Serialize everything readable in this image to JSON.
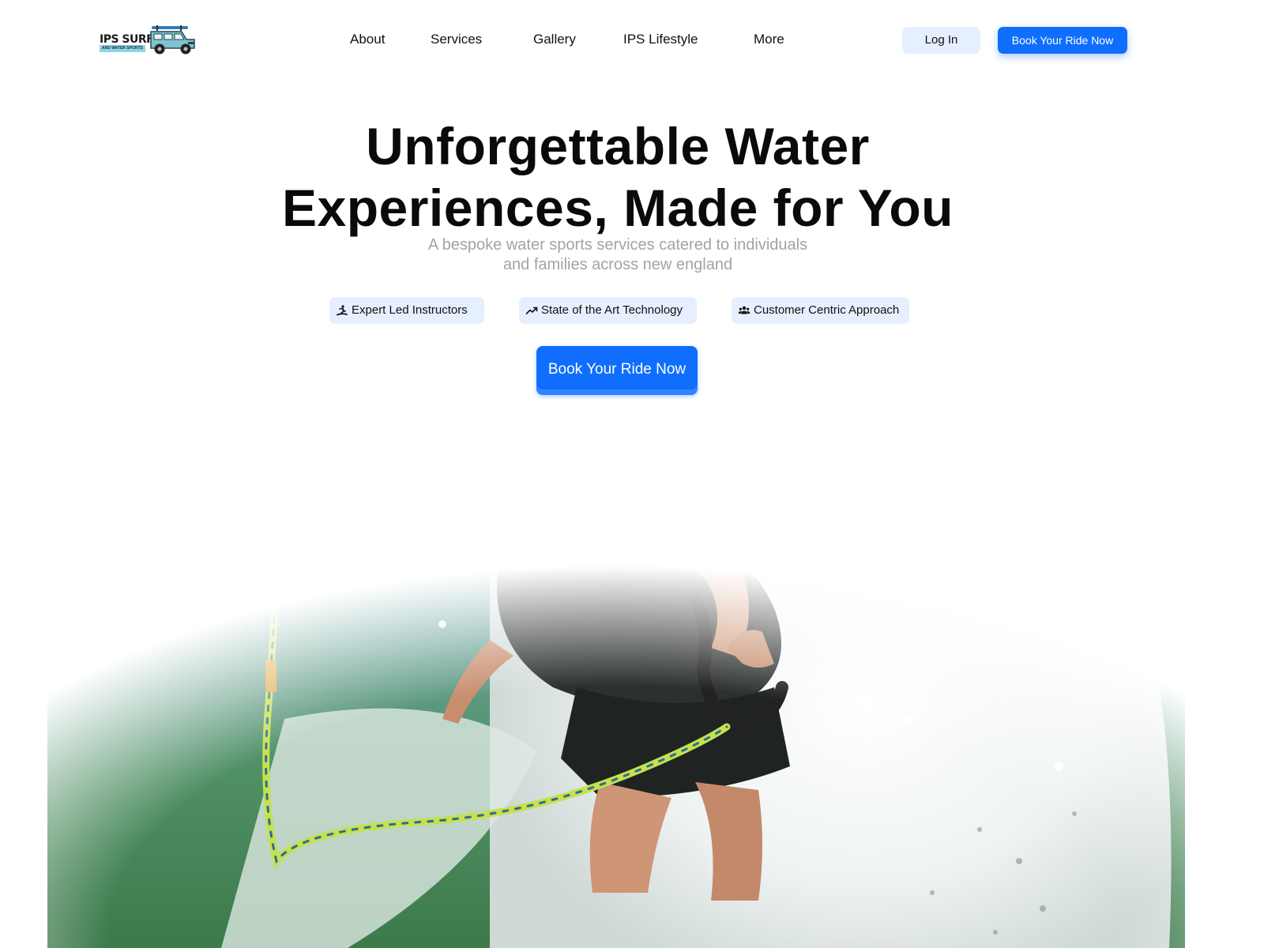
{
  "brand": {
    "name": "IPS SURF",
    "tagline": "AND WATER SPORTS",
    "logo_icon": "jeep-with-surfboard-icon"
  },
  "nav": {
    "links": [
      "About",
      "Services",
      "Gallery",
      "IPS Lifestyle",
      "More"
    ],
    "login_label": "Log In",
    "book_label": "Book Your Ride Now"
  },
  "hero": {
    "title_line1": "Unforgettable Water",
    "title_line2": "Experiences, Made for You",
    "subtitle_line1": "A bespoke water sports services catered to individuals",
    "subtitle_line2": "and families across new england",
    "features": [
      {
        "label": "Expert Led Instructors",
        "icon": "surfer-icon"
      },
      {
        "label": "State of the Art Technology",
        "icon": "trending-up-icon"
      },
      {
        "label": "Customer Centric Approach",
        "icon": "users-icon"
      }
    ],
    "cta_label": "Book Your Ride Now",
    "image": "wakesurfer-photo"
  },
  "colors": {
    "accent": "#0f6efd",
    "pill_bg": "#e6efff",
    "subtitle": "#a3a3a3"
  }
}
